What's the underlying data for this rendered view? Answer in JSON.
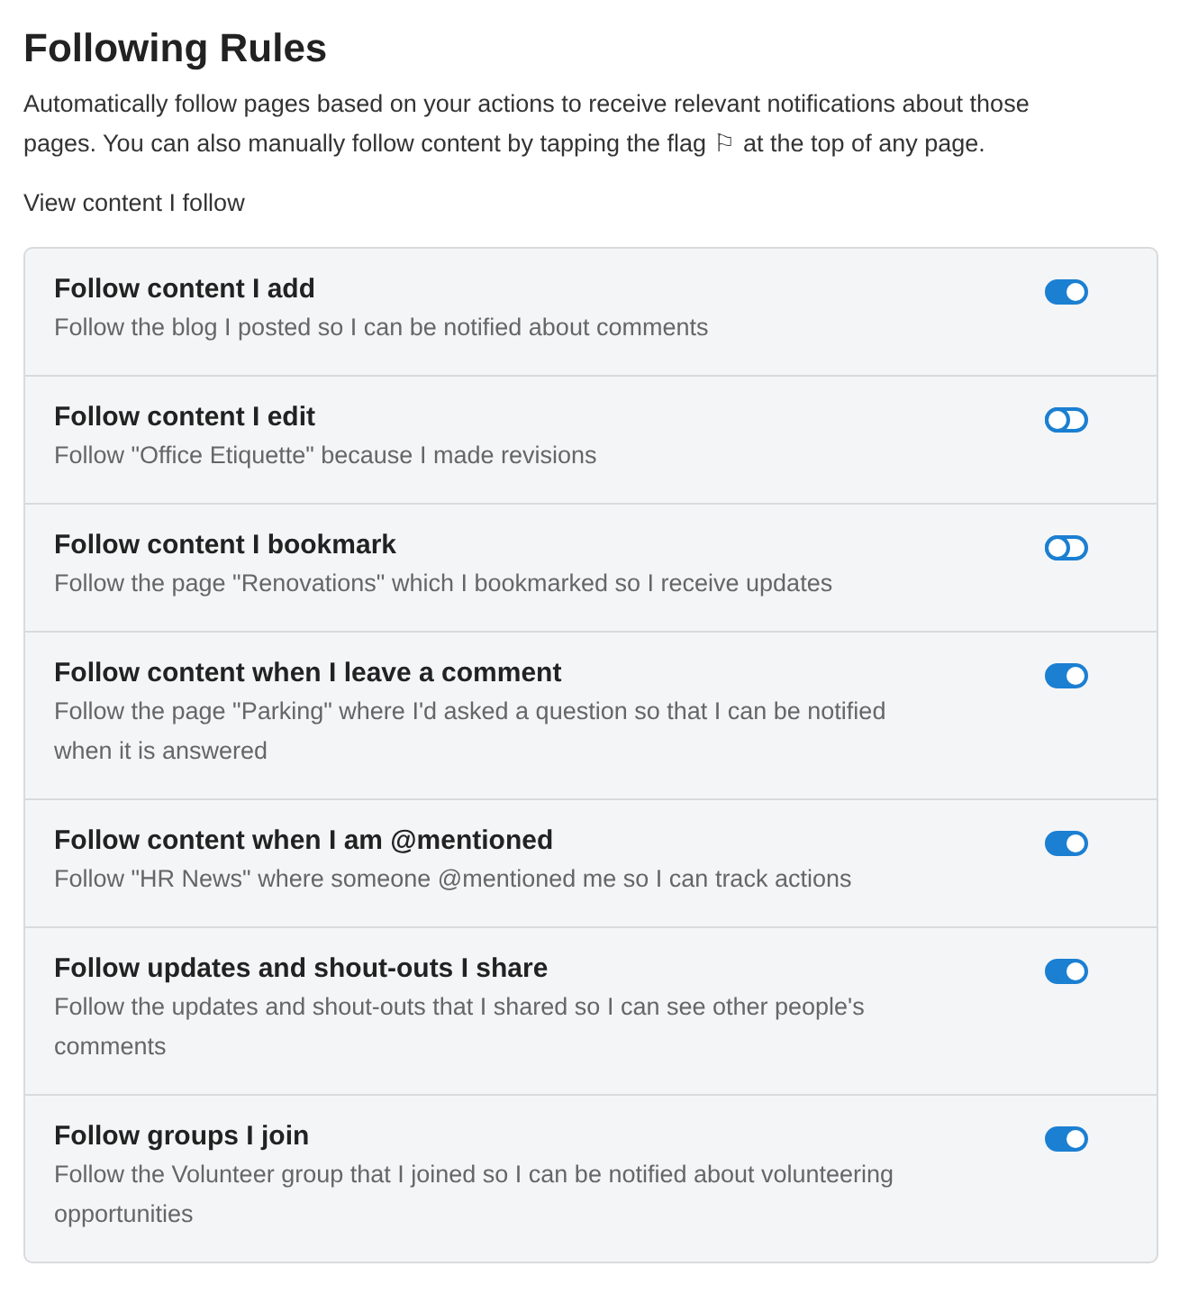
{
  "title": "Following Rules",
  "intro": "Automatically follow pages based on your actions to receive relevant notifications about those pages. You can also manually follow content by tapping the flag ⚐ at the top of any page.",
  "link": "View content I follow",
  "rules": [
    {
      "title": "Follow content I add",
      "description": "Follow the blog I posted so I can be notified about comments",
      "on": true
    },
    {
      "title": "Follow content I edit",
      "description": "Follow \"Office Etiquette\" because I made revisions",
      "on": false
    },
    {
      "title": "Follow content I bookmark",
      "description": "Follow the page \"Renovations\" which I bookmarked so I receive updates",
      "on": false
    },
    {
      "title": "Follow content when I leave a comment",
      "description": "Follow the page \"Parking\" where I'd asked a question so that I can be notified when it is answered",
      "on": true
    },
    {
      "title": "Follow content when I am @mentioned",
      "description": "Follow \"HR News\" where someone @mentioned me so I can track actions",
      "on": true
    },
    {
      "title": "Follow updates and shout-outs I share",
      "description": "Follow the updates and shout-outs that I shared so I can see other people's comments",
      "on": true
    },
    {
      "title": "Follow groups I join",
      "description": "Follow the Volunteer group that I joined so I can be notified about volunteering opportunities",
      "on": true
    }
  ]
}
